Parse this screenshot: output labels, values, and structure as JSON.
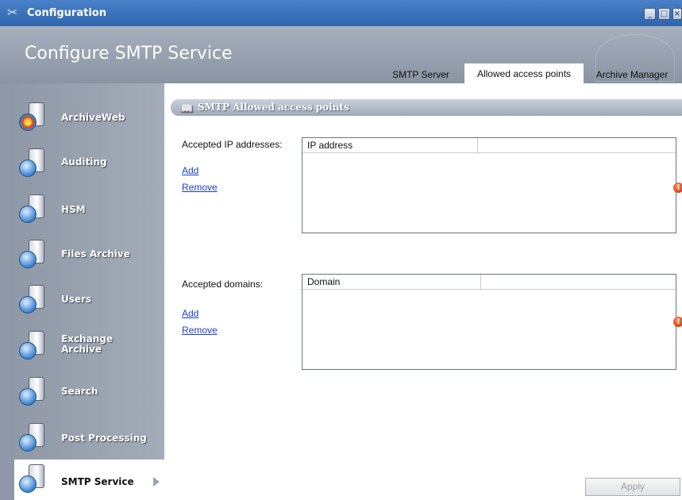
{
  "window": {
    "title": "Configuration",
    "app_icon": "tools-icon"
  },
  "header": {
    "page_title": "Configure SMTP Service",
    "tabs": [
      {
        "label": "SMTP Server"
      },
      {
        "label": "Allowed access points",
        "active": true
      },
      {
        "label": "Archive Manager"
      }
    ]
  },
  "sidebar": {
    "items": [
      {
        "label": "ArchiveWeb",
        "icon": "archiveweb-icon"
      },
      {
        "label": "Auditing",
        "icon": "auditing-icon"
      },
      {
        "label": "HSM",
        "icon": "hsm-icon"
      },
      {
        "label": "Files Archive",
        "icon": "files-archive-icon"
      },
      {
        "label": "Users",
        "icon": "users-icon"
      },
      {
        "label": "Exchange",
        "label2": "Archive",
        "icon": "exchange-archive-icon"
      },
      {
        "label": "Search",
        "icon": "search-icon"
      },
      {
        "label": "Post Processing",
        "icon": "post-processing-icon"
      },
      {
        "label": "SMTP Service",
        "icon": "smtp-service-icon",
        "active": true
      }
    ]
  },
  "main": {
    "group_title": "SMTP Allowed access points",
    "ip_section": {
      "label": "Accepted IP addresses:",
      "add_label": "Add",
      "remove_label": "Remove",
      "column": "IP address"
    },
    "domain_section": {
      "label": "Accepted domains:",
      "add_label": "Add",
      "remove_label": "Remove",
      "column": "Domain"
    },
    "apply_label": "Apply"
  },
  "colors": {
    "titlebar": "#2f64ad",
    "sidebar": "#97a0ad",
    "link": "#1a3fc8",
    "error": "#d63b10"
  }
}
